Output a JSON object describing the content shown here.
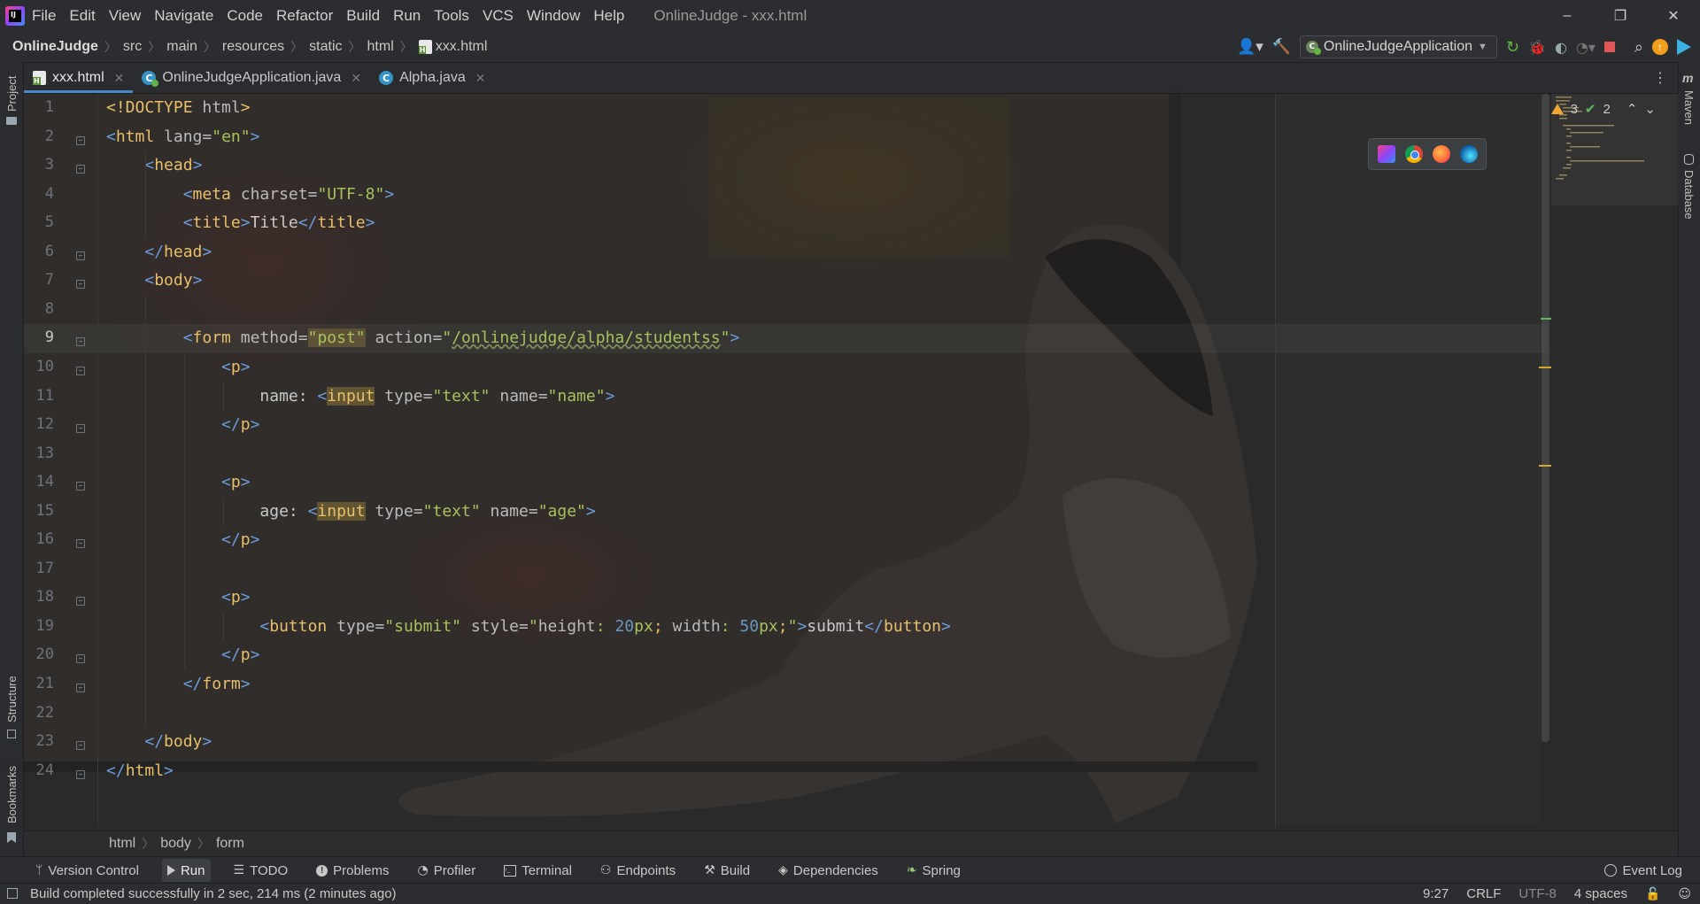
{
  "window": {
    "title": "OnlineJudge - xxx.html",
    "menu": [
      "File",
      "Edit",
      "View",
      "Navigate",
      "Code",
      "Refactor",
      "Build",
      "Run",
      "Tools",
      "VCS",
      "Window",
      "Help"
    ],
    "controls": {
      "minimize": "–",
      "restore": "❐",
      "close": "✕"
    }
  },
  "breadcrumb": {
    "items": [
      "OnlineJudge",
      "src",
      "main",
      "resources",
      "static",
      "html",
      "xxx.html"
    ]
  },
  "run_config": {
    "label": "OnlineJudgeApplication"
  },
  "tabs": [
    {
      "label": "xxx.html",
      "type": "html",
      "active": true
    },
    {
      "label": "OnlineJudgeApplication.java",
      "type": "spring-class",
      "active": false
    },
    {
      "label": "Alpha.java",
      "type": "class",
      "active": false
    }
  ],
  "side_tools": {
    "left": [
      "Project",
      "Structure",
      "Bookmarks"
    ],
    "right": [
      "Maven",
      "Database"
    ]
  },
  "inspections": {
    "warnings": "3",
    "ok": "2"
  },
  "editor": {
    "current_line": 9,
    "line_numbers": [
      "1",
      "2",
      "3",
      "4",
      "5",
      "6",
      "7",
      "8",
      "9",
      "10",
      "11",
      "12",
      "13",
      "14",
      "15",
      "16",
      "17",
      "18",
      "19",
      "20",
      "21",
      "22",
      "23",
      "24"
    ],
    "lines": [
      "<!DOCTYPE html>",
      "<html lang=\"en\">",
      "    <head>",
      "        <meta charset=\"UTF-8\">",
      "        <title>Title</title>",
      "    </head>",
      "    <body>",
      "",
      "        <form method=\"post\" action=\"/onlinejudge/alpha/studentss\">",
      "            <p>",
      "                name: <input type=\"text\" name=\"name\">",
      "            </p>",
      "",
      "            <p>",
      "                age: <input type=\"text\" name=\"age\">",
      "            </p>",
      "",
      "            <p>",
      "                <button type=\"submit\" style=\"height: 20px; width: 50px;\">submit</button>",
      "            </p>",
      "        </form>",
      "",
      "    </body>",
      "</html>"
    ]
  },
  "code_breadcrumb": [
    "html",
    "body",
    "form"
  ],
  "tool_windows": [
    {
      "label": "Version Control",
      "icon": "branch-icon"
    },
    {
      "label": "Run",
      "icon": "run-icon",
      "active": true
    },
    {
      "label": "TODO",
      "icon": "list-icon"
    },
    {
      "label": "Problems",
      "icon": "info-icon"
    },
    {
      "label": "Profiler",
      "icon": "profiler-icon"
    },
    {
      "label": "Terminal",
      "icon": "terminal-icon"
    },
    {
      "label": "Endpoints",
      "icon": "endpoints-icon"
    },
    {
      "label": "Build",
      "icon": "hammer-icon"
    },
    {
      "label": "Dependencies",
      "icon": "layers-icon"
    },
    {
      "label": "Spring",
      "icon": "spring-icon"
    }
  ],
  "event_log": "Event Log",
  "status": {
    "message": "Build completed successfully in 2 sec, 214 ms (2 minutes ago)",
    "caret": "9:27",
    "line_separator": "CRLF",
    "encoding": "UTF-8",
    "indent": "4 spaces"
  },
  "colors": {
    "tag": "#e8bf6a",
    "string": "#a5c25c",
    "attribute": "#bababa",
    "number": "#6897bb",
    "accent": "#4a88c7"
  }
}
